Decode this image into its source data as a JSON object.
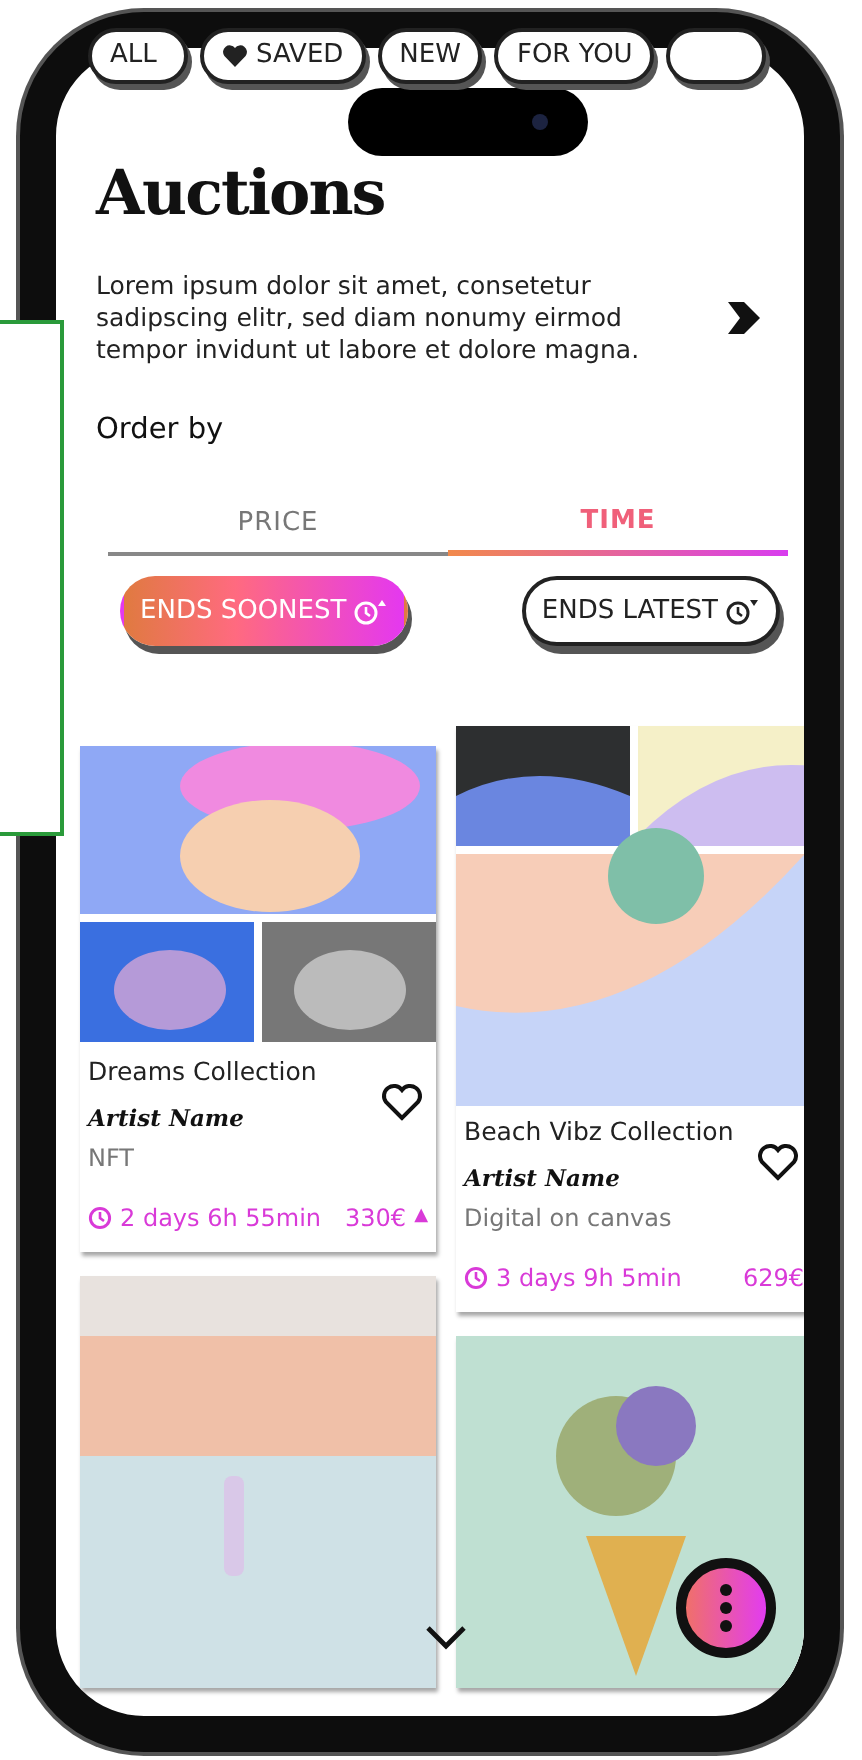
{
  "filter_chips": [
    {
      "label": "ALL",
      "kind": "plain",
      "selected": false
    },
    {
      "label": "SAVED",
      "kind": "heart",
      "selected": false
    },
    {
      "label": "NEW",
      "kind": "plain",
      "selected": false
    },
    {
      "label": "FOR YOU",
      "kind": "plain",
      "selected": false
    },
    {
      "kind": "plain",
      "selected": false
    }
  ],
  "title": "Auctions",
  "description": "Lorem ipsum dolor sit amet, consetetur sadipscing elitr, sed diam nonumy eirmod tempor invidunt ut labore et dolore magna.",
  "order_by": {
    "label": "Order by",
    "tabs": [
      {
        "label": "PRICE",
        "selected": false
      },
      {
        "label": "TIME",
        "selected": true
      }
    ],
    "sort_buttons": [
      {
        "label": "ENDS SOONEST",
        "kind": "ascending",
        "selected": true
      },
      {
        "label": "ENDS LATEST",
        "kind": "descending",
        "selected": false
      }
    ]
  },
  "cards": [
    {
      "kind": "elephant",
      "title": "Dreams Collection",
      "artist": "Artist Name",
      "medium": "NFT",
      "time": "2 days 6h 55min",
      "price": "330€",
      "trend": "▲"
    },
    {
      "kind": "beach",
      "title": "Beach Vibz Collection",
      "artist": "Artist Name",
      "medium": "Digital on canvas",
      "time": "3 days 9h 5min",
      "price": "629€"
    },
    {
      "kind": "walker"
    },
    {
      "kind": "icecream"
    }
  ]
}
